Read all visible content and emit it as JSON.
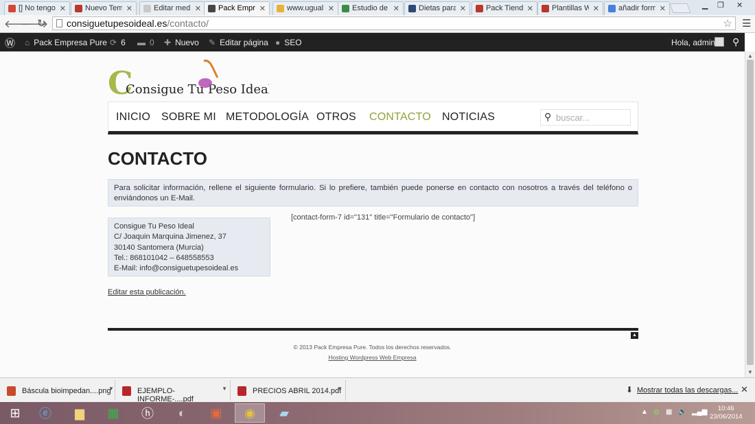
{
  "browser": {
    "tabs": [
      {
        "label": "[] No tengo",
        "favicon": "gmail-icon",
        "color": "#d14836"
      },
      {
        "label": "Nuevo Tema",
        "favicon": "uws-icon",
        "color": "#b8372e"
      },
      {
        "label": "Editar medio",
        "favicon": "page-icon",
        "color": "#c9c9c9"
      },
      {
        "label": "Pack Empresa",
        "favicon": "wordpress-icon",
        "color": "#464646"
      },
      {
        "label": "www.ugualit",
        "favicon": "ugualit-icon",
        "color": "#e8b23a"
      },
      {
        "label": "Estudio de c",
        "favicon": "gear-icon",
        "color": "#3a8d47"
      },
      {
        "label": "Dietas para p",
        "favicon": "vk-icon",
        "color": "#2c4a74"
      },
      {
        "label": "Pack Tienda",
        "favicon": "uws-icon",
        "color": "#b8372e"
      },
      {
        "label": "Plantillas W",
        "favicon": "uws-icon",
        "color": "#b8372e"
      },
      {
        "label": "añadir form",
        "favicon": "google-icon",
        "color": "#4a7fdb"
      }
    ],
    "url_domain": "consiguetupesoideal.es",
    "url_path": "/contacto/"
  },
  "adminbar": {
    "site_name": "Pack Empresa Pure",
    "updates": "6",
    "comments": "0",
    "new_label": "Nuevo",
    "edit_label": "Editar página",
    "seo_label": "SEO",
    "greeting": "Hola, admin"
  },
  "site": {
    "logo_text": "Consigue Tu Peso Ideal",
    "menu": [
      "INICIO",
      "SOBRE MI",
      "METODOLOGÍA",
      "OTROS",
      "CONTACTO",
      "NOTICIAS"
    ],
    "current_menu_index": 4,
    "search_placeholder": "buscar...",
    "page_title": "CONTACTO",
    "intro": "Para solicitar información, rellene el siguiente formulario. Si lo prefiere, también puede ponerse en contacto con nosotros a través del teléfono o enviándonos un E-Mail.",
    "address_lines": [
      "Consigue Tu Peso Ideal",
      "C/ Joaquin Marquina Jimenez, 37",
      "30140 Santomera (Murcia)",
      "Tel.: 868101042 – 648558553",
      "E-Mail: info@consiguetupesoideal.es"
    ],
    "shortcode": "[contact-form-7 id=\"131\" title=\"Formulario de contacto\"]",
    "edit_link": "Editar esta publicación.",
    "copyright": "© 2013 Pack Empresa Pure. Todos los derechos reservados.",
    "hosting": "Hosting Wordpress Web Empresa",
    "accent_color": "#8fa33b"
  },
  "downloads": {
    "items": [
      {
        "name": "Báscula bioimpedan....png",
        "icon": "image-file-icon"
      },
      {
        "name": "EJEMPLO-INFORME-....pdf",
        "icon": "pdf-file-icon"
      },
      {
        "name": "PRECIOS ABRIL 2014.pdf",
        "icon": "pdf-file-icon"
      }
    ],
    "show_all": "Mostrar todas las descargas..."
  },
  "taskbar": {
    "time": "10:46",
    "date": "23/06/2014"
  }
}
